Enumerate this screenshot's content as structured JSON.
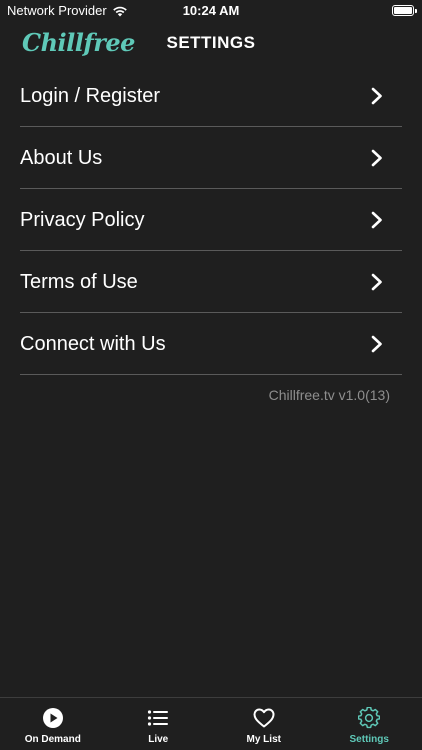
{
  "status_bar": {
    "carrier": "Network Provider",
    "time": "10:24 AM",
    "wifi_icon": "wifi-icon",
    "battery_icon": "battery-icon"
  },
  "header": {
    "logo_text": "Chillfree",
    "title": "SETTINGS"
  },
  "settings": {
    "items": [
      {
        "label": "Login / Register",
        "icon": "chevron-right-icon"
      },
      {
        "label": "About Us",
        "icon": "chevron-right-icon"
      },
      {
        "label": "Privacy Policy",
        "icon": "chevron-right-icon"
      },
      {
        "label": "Terms of Use",
        "icon": "chevron-right-icon"
      },
      {
        "label": "Connect with Us",
        "icon": "chevron-right-icon"
      }
    ],
    "version": "Chillfree.tv v1.0(13)"
  },
  "tab_bar": {
    "tabs": [
      {
        "label": "On Demand",
        "icon": "play-circle-icon",
        "active": false
      },
      {
        "label": "Live",
        "icon": "list-icon",
        "active": false
      },
      {
        "label": "My List",
        "icon": "heart-icon",
        "active": false
      },
      {
        "label": "Settings",
        "icon": "gear-icon",
        "active": true
      }
    ]
  },
  "colors": {
    "background": "#1f1f1f",
    "accent": "#5fc9b8",
    "divider": "#5a5a5a",
    "version_text": "#8e8e8e"
  }
}
